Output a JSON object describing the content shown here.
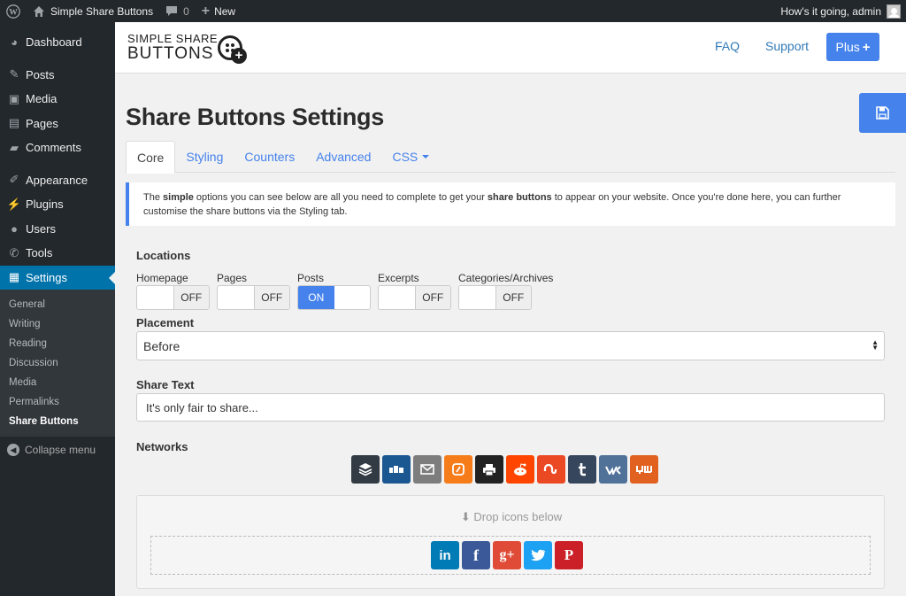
{
  "admin_bar": {
    "site_name": "Simple Share Buttons",
    "comments_count": "0",
    "new_label": "New",
    "greeting": "How's it going, admin"
  },
  "sidebar": {
    "items": [
      {
        "label": "Dashboard",
        "icon": "dashboard-icon"
      },
      {
        "label": "Posts",
        "icon": "pin-icon"
      },
      {
        "label": "Media",
        "icon": "media-icon"
      },
      {
        "label": "Pages",
        "icon": "pages-icon"
      },
      {
        "label": "Comments",
        "icon": "comment-icon"
      },
      {
        "label": "Appearance",
        "icon": "brush-icon"
      },
      {
        "label": "Plugins",
        "icon": "plug-icon"
      },
      {
        "label": "Users",
        "icon": "user-icon"
      },
      {
        "label": "Tools",
        "icon": "wrench-icon"
      },
      {
        "label": "Settings",
        "icon": "settings-icon"
      }
    ],
    "submenu": [
      "General",
      "Writing",
      "Reading",
      "Discussion",
      "Media",
      "Permalinks",
      "Share Buttons"
    ],
    "collapse_label": "Collapse menu"
  },
  "header": {
    "logo_top": "SIMPLE SHARE",
    "logo_bottom": "BUTTONS",
    "faq": "FAQ",
    "support": "Support",
    "plus": "Plus"
  },
  "page": {
    "title": "Share Buttons Settings",
    "tabs": [
      "Core",
      "Styling",
      "Counters",
      "Advanced",
      "CSS"
    ],
    "intro_1": "The ",
    "intro_2": "simple",
    "intro_3": " options you can see below are all you need to complete to get your ",
    "intro_4": "share buttons",
    "intro_5": " to appear on your website. Once you're done here, you can further customise the share buttons via the Styling tab."
  },
  "locations": {
    "label": "Locations",
    "items": [
      {
        "label": "Homepage",
        "state": "OFF"
      },
      {
        "label": "Pages",
        "state": "OFF"
      },
      {
        "label": "Posts",
        "state": "ON"
      },
      {
        "label": "Excerpts",
        "state": "OFF"
      },
      {
        "label": "Categories/Archives",
        "state": "OFF"
      }
    ]
  },
  "placement": {
    "label": "Placement",
    "value": "Before"
  },
  "share_text": {
    "label": "Share Text",
    "value": "It's only fair to share..."
  },
  "networks": {
    "label": "Networks",
    "available": [
      {
        "icon": "buffer-icon",
        "color": "#323b43"
      },
      {
        "icon": "diggit-icon",
        "color": "#1b5791"
      },
      {
        "icon": "email-icon",
        "color": "#7d7d7d"
      },
      {
        "icon": "flattr-icon",
        "color": "#f67c1a"
      },
      {
        "icon": "print-icon",
        "color": "#222222"
      },
      {
        "icon": "reddit-icon",
        "color": "#ff4500"
      },
      {
        "icon": "stumbleupon-icon",
        "color": "#eb4924"
      },
      {
        "icon": "tumblr-icon",
        "color": "#36465d"
      },
      {
        "icon": "vk-icon",
        "color": "#507299"
      },
      {
        "icon": "yummly-icon",
        "color": "#e16120"
      }
    ],
    "drop_label": "Drop icons below",
    "selected": [
      {
        "icon": "linkedin-icon",
        "color": "#007bb5",
        "glyph": "in"
      },
      {
        "icon": "facebook-icon",
        "color": "#3b5998",
        "glyph": "f"
      },
      {
        "icon": "google-plus-icon",
        "color": "#df4b37",
        "glyph": "g+"
      },
      {
        "icon": "twitter-icon",
        "color": "#1da1f2",
        "glyph": ""
      },
      {
        "icon": "pinterest-icon",
        "color": "#cb2027",
        "glyph": "P"
      }
    ]
  },
  "colors": {
    "accent": "#4582ec",
    "admin_bg": "#23282d",
    "active_menu": "#0073aa"
  }
}
